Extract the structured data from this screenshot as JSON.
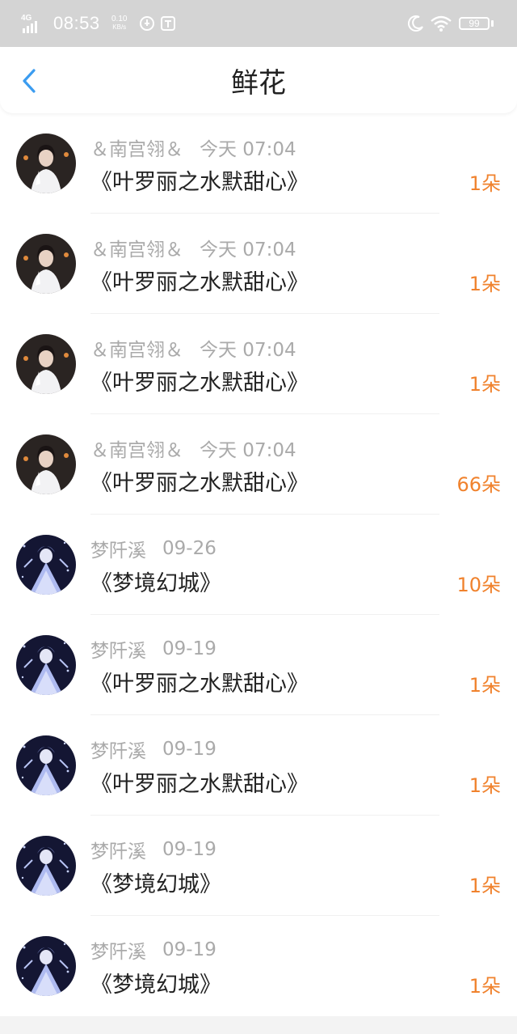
{
  "status_bar": {
    "network": "4G",
    "time": "08:53",
    "speed_value": "0.10",
    "speed_unit": "KB/s",
    "battery": "99",
    "background": "#d4d4d4"
  },
  "header": {
    "title": "鲜花",
    "back_icon": "chevron-left-icon",
    "accent": "#3b9cf0"
  },
  "accent_count_color": "#f0822d",
  "items": [
    {
      "sender": "＆南宫翎＆",
      "time": "今天 07:04",
      "gift": "《叶罗丽之水默甜心》",
      "count": "1朵",
      "avatar": "avatar-girl-white"
    },
    {
      "sender": "＆南宫翎＆",
      "time": "今天 07:04",
      "gift": "《叶罗丽之水默甜心》",
      "count": "1朵",
      "avatar": "avatar-girl-white"
    },
    {
      "sender": "＆南宫翎＆",
      "time": "今天 07:04",
      "gift": "《叶罗丽之水默甜心》",
      "count": "1朵",
      "avatar": "avatar-girl-white"
    },
    {
      "sender": "＆南宫翎＆",
      "time": "今天 07:04",
      "gift": "《叶罗丽之水默甜心》",
      "count": "66朵",
      "avatar": "avatar-girl-white"
    },
    {
      "sender": "梦阡溪",
      "time": "09-26",
      "gift": "《梦境幻城》",
      "count": "10朵",
      "avatar": "avatar-fairy-night"
    },
    {
      "sender": "梦阡溪",
      "time": "09-19",
      "gift": "《叶罗丽之水默甜心》",
      "count": "1朵",
      "avatar": "avatar-fairy-night"
    },
    {
      "sender": "梦阡溪",
      "time": "09-19",
      "gift": "《叶罗丽之水默甜心》",
      "count": "1朵",
      "avatar": "avatar-fairy-night"
    },
    {
      "sender": "梦阡溪",
      "time": "09-19",
      "gift": "《梦境幻城》",
      "count": "1朵",
      "avatar": "avatar-fairy-night"
    },
    {
      "sender": "梦阡溪",
      "time": "09-19",
      "gift": "《梦境幻城》",
      "count": "1朵",
      "avatar": "avatar-fairy-night"
    }
  ]
}
